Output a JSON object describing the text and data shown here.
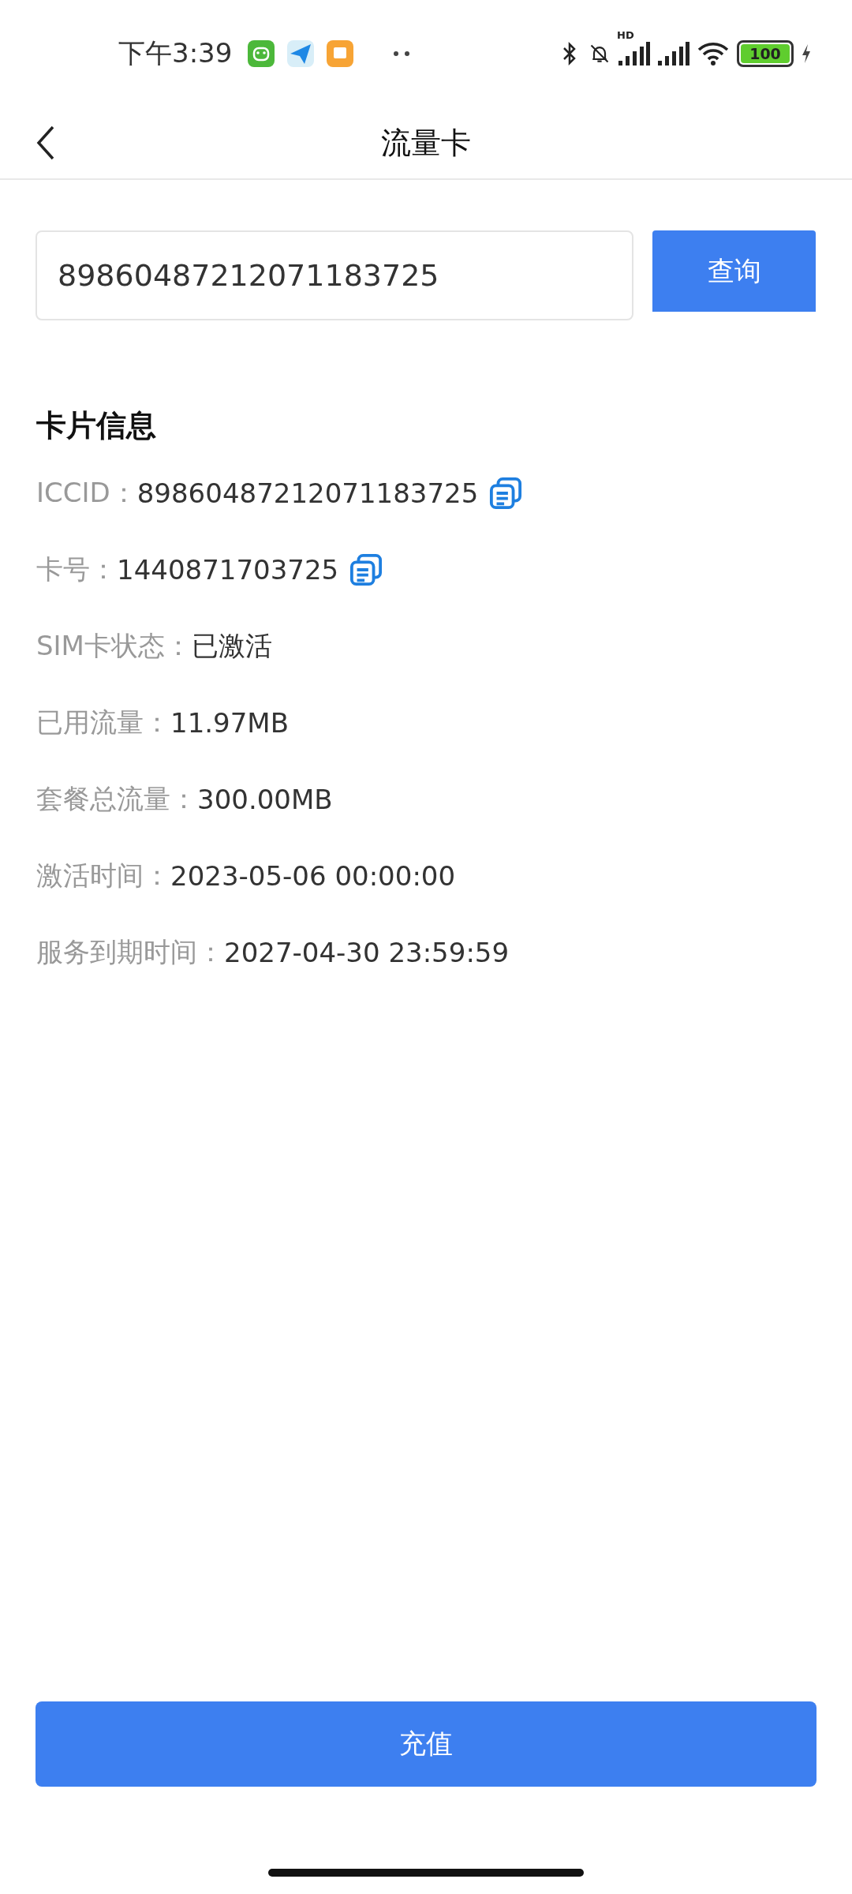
{
  "status_bar": {
    "time": "下午3:39",
    "hd_label": "HD",
    "battery": "100",
    "charging": true
  },
  "header": {
    "title": "流量卡"
  },
  "search": {
    "value": "89860487212071183725",
    "button": "查询"
  },
  "card_info": {
    "title": "卡片信息",
    "rows": [
      {
        "label": "ICCID：",
        "value": "89860487212071183725",
        "copyable": true
      },
      {
        "label": "卡号：",
        "value": "1440871703725",
        "copyable": true
      },
      {
        "label": "SIM卡状态：",
        "value": "已激活",
        "copyable": false
      },
      {
        "label": "已用流量：",
        "value": "11.97MB",
        "copyable": false
      },
      {
        "label": "套餐总流量：",
        "value": "300.00MB",
        "copyable": false
      },
      {
        "label": "激活时间：",
        "value": "2023-05-06 00:00:00",
        "copyable": false
      },
      {
        "label": "服务到期时间：",
        "value": "2027-04-30 23:59:59",
        "copyable": false
      }
    ]
  },
  "recharge_button": "充值"
}
